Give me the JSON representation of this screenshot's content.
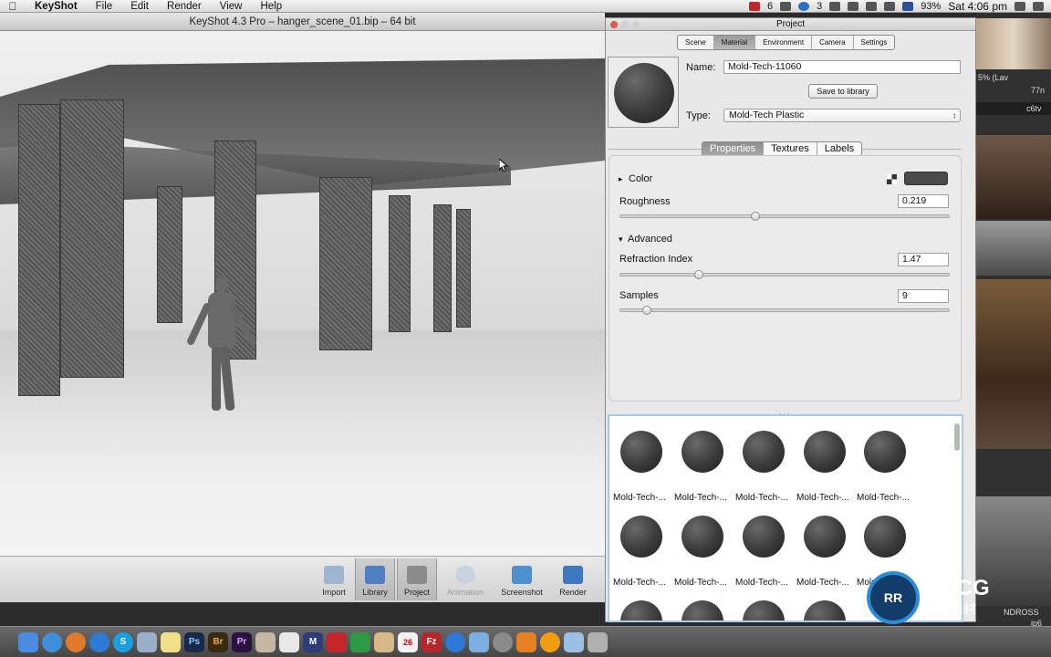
{
  "menubar": {
    "app_name": "KeyShot",
    "items": [
      "File",
      "Edit",
      "Render",
      "View",
      "Help"
    ],
    "status": {
      "badge_count": "6",
      "badge_count2": "3",
      "battery": "93%",
      "clock": "Sat 4:06 pm"
    }
  },
  "window": {
    "title": "KeyShot 4.3 Pro  – hanger_scene_01.bip  – 64 bit"
  },
  "toolbar": {
    "buttons": [
      {
        "label": "Import",
        "icon": "import-icon"
      },
      {
        "label": "Library",
        "icon": "library-icon"
      },
      {
        "label": "Project",
        "icon": "project-icon"
      },
      {
        "label": "Animation",
        "icon": "animation-icon"
      },
      {
        "label": "Screenshot",
        "icon": "screenshot-icon"
      },
      {
        "label": "Render",
        "icon": "render-icon"
      }
    ]
  },
  "project": {
    "title": "Project",
    "tabs": [
      "Scene",
      "Material",
      "Environment",
      "Camera",
      "Settings"
    ],
    "active_tab": "Material",
    "name_label": "Name:",
    "name_value": "Mold-Tech-11060",
    "save_button": "Save to library",
    "type_label": "Type:",
    "type_value": "Mold-Tech Plastic",
    "subtabs": [
      "Properties",
      "Textures",
      "Labels"
    ],
    "properties": {
      "color_label": "Color",
      "roughness_label": "Roughness",
      "roughness_value": "0.219",
      "roughness_fraction": 0.41,
      "advanced_label": "Advanced",
      "refraction_label": "Refraction Index",
      "refraction_value": "1.47",
      "refraction_fraction": 0.24,
      "samples_label": "Samples",
      "samples_value": "9",
      "samples_fraction": 0.08
    },
    "library_items": [
      "Mold-Tech-...",
      "Mold-Tech-...",
      "Mold-Tech-...",
      "Mold-Tech-...",
      "Mold-Tech-...",
      "Mold-Tech-...",
      "Mold-Tech-...",
      "Mold-Tech-...",
      "Mold-Tech-...",
      "Mold-T..."
    ]
  },
  "right_strip": {
    "label1": "5% (Lav",
    "label2": "77n",
    "label3": "c6tv",
    "label4": "NDROSS",
    "label5": "ip6"
  },
  "watermark": {
    "brand": "RRCG",
    "sub": "人人素材"
  },
  "dock": {
    "icons": [
      "finder-icon",
      "safari-icon",
      "firefox-icon",
      "chrome-icon",
      "skype-icon",
      "app-icon",
      "notes-icon",
      "photoshop-icon",
      "bridge-icon",
      "premiere-icon",
      "maps-icon",
      "preview-icon",
      "mail-icon",
      "excel-icon",
      "files-icon",
      "calendar-icon",
      "calendar-icon",
      "filezilla-icon",
      "appstore-icon",
      "finder-icon",
      "settings-icon",
      "vlc-icon",
      "ball-icon",
      "folder-icon",
      "trash-icon"
    ]
  }
}
